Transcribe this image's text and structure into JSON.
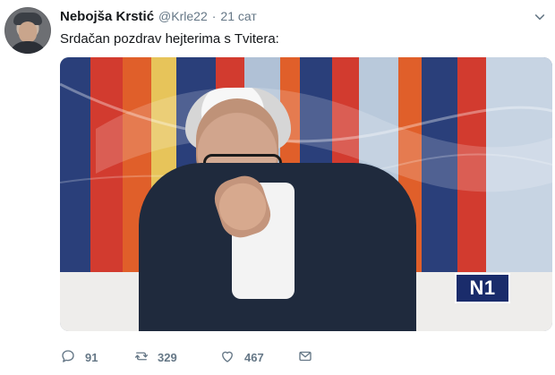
{
  "tweet": {
    "display_name": "Nebojša Krstić",
    "handle": "@Krle22",
    "separator": "·",
    "timestamp": "21 сат",
    "text": "Srdačan pozdrav hejterima s Tvitera:",
    "media": {
      "broadcaster_logo_text": "N1"
    },
    "actions": {
      "replies": "91",
      "retweets": "329",
      "likes": "467"
    }
  },
  "icons": {
    "more": "chevron-down-icon",
    "reply": "reply-icon",
    "retweet": "retweet-icon",
    "like": "heart-icon",
    "message": "mail-icon"
  },
  "colors": {
    "text_primary": "#14171a",
    "text_secondary": "#657786",
    "n1_blue": "#1a2c6b",
    "set_red": "#d23b2f",
    "set_orange": "#e05f2a",
    "set_blue": "#2a3f7a"
  }
}
